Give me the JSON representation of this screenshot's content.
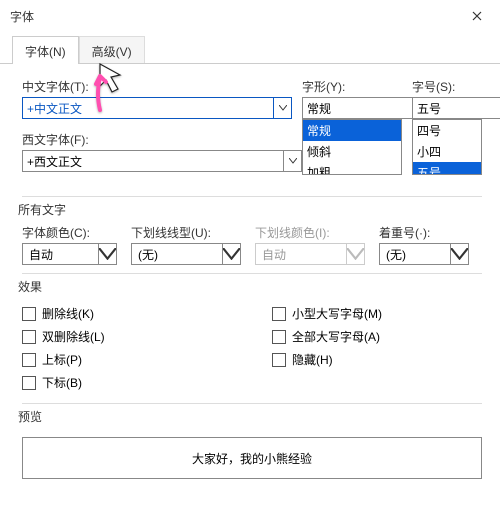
{
  "window": {
    "title": "字体"
  },
  "tabs": {
    "font": "字体(N)",
    "advanced": "高级(V)"
  },
  "cn_font": {
    "label": "中文字体(T):",
    "value": "+中文正文"
  },
  "en_font": {
    "label": "西文字体(F):",
    "value": "+西文正文"
  },
  "style": {
    "label": "字形(Y):",
    "value": "常规",
    "options": [
      "常规",
      "倾斜",
      "加粗"
    ]
  },
  "size": {
    "label": "字号(S):",
    "value": "五号",
    "options": [
      "四号",
      "小四",
      "五号"
    ]
  },
  "allText": {
    "head": "所有文字",
    "color": {
      "label": "字体颜色(C):",
      "value": "自动"
    },
    "underline": {
      "label": "下划线线型(U):",
      "value": "(无)"
    },
    "ulColor": {
      "label": "下划线颜色(I):",
      "value": "自动"
    },
    "emphasis": {
      "label": "着重号(·):",
      "value": "(无)"
    }
  },
  "effects": {
    "head": "效果",
    "strike": "删除线(K)",
    "dblStrike": "双删除线(L)",
    "sup": "上标(P)",
    "sub": "下标(B)",
    "smallCaps": "小型大写字母(M)",
    "allCaps": "全部大写字母(A)",
    "hidden": "隐藏(H)"
  },
  "preview": {
    "head": "预览",
    "text": "大家好，我的小熊经验"
  }
}
